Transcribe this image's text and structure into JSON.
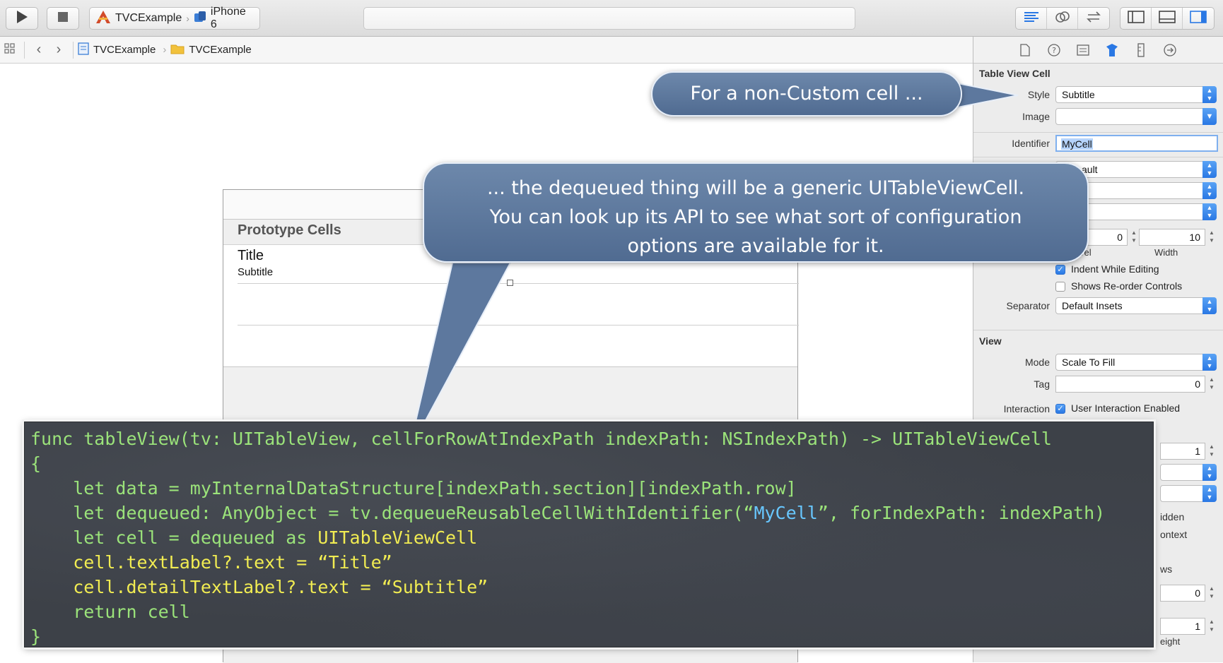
{
  "toolbar": {
    "scheme_project": "TVCExample",
    "scheme_device": "iPhone 6",
    "icons": [
      "run-icon",
      "stop-icon",
      "standard-editor-icon",
      "assistant-editor-icon",
      "version-editor-icon",
      "navigator-toggle-icon",
      "debug-area-toggle-icon",
      "utilities-toggle-icon"
    ]
  },
  "jumpbar": {
    "project": "TVCExample",
    "group": "TVCExample"
  },
  "canvas": {
    "section_header": "Prototype Cells",
    "cell_title": "Title",
    "cell_subtitle": "Subtitle"
  },
  "inspector": {
    "section_table_view_cell": "Table View Cell",
    "style_label": "Style",
    "style_value": "Subtitle",
    "image_label": "Image",
    "image_value": "",
    "identifier_label": "Identifier",
    "identifier_value": "MyCell",
    "partial_popup_text": "ault",
    "indent_level_value": "0",
    "indent_width_value": "10",
    "indent_level_partial_label": "vel",
    "width_label": "Width",
    "indent_while_editing": "Indent While Editing",
    "shows_reorder": "Shows Re-order Controls",
    "separator_label": "Separator",
    "separator_value": "Default Insets",
    "section_view": "View",
    "mode_label": "Mode",
    "mode_value": "Scale To Fill",
    "tag_label": "Tag",
    "tag_value": "0",
    "interaction_label": "Interaction",
    "user_interaction": "User Interaction Enabled",
    "alpha_value": "1",
    "peek_hidden": "idden",
    "peek_context": "ontext",
    "peek_ws": "ws",
    "peek_zero": "0",
    "peek_one": "1",
    "peek_height": "eight"
  },
  "callouts": {
    "first": "For a non-Custom cell ...",
    "second_lines": [
      "... the dequeued thing will be a generic UITableViewCell.",
      "You can look up its API to see what sort of configuration",
      "options are available for it."
    ]
  },
  "code": {
    "line1": "func tableView(tv: UITableView, cellForRowAtIndexPath indexPath: NSIndexPath) -> UITableViewCell",
    "line2": "{",
    "line3": "    let data = myInternalDataStructure[indexPath.section][indexPath.row]",
    "line4_a": "    let dequeued: AnyObject = tv.dequeueReusableCellWithIdentifier(“",
    "line4_b": "MyCell",
    "line4_c": "”, forIndexPath: indexPath)",
    "line5_a": "    let cell = dequeued as ",
    "line5_b": "UITableViewCell",
    "line6_a": "    cell.textLabel?.text = ",
    "line6_b": "“Title”",
    "line7_a": "    cell.detailTextLabel?.text = ",
    "line7_b": "“Subtitle”",
    "line8": "    return cell",
    "line9": "}"
  },
  "colors": {
    "code_green": "#9be37a",
    "code_yellow": "#f1ec52",
    "code_blue": "#68c7ff",
    "callout_blue": "#5d789e",
    "accent_blue": "#2a78e4"
  }
}
